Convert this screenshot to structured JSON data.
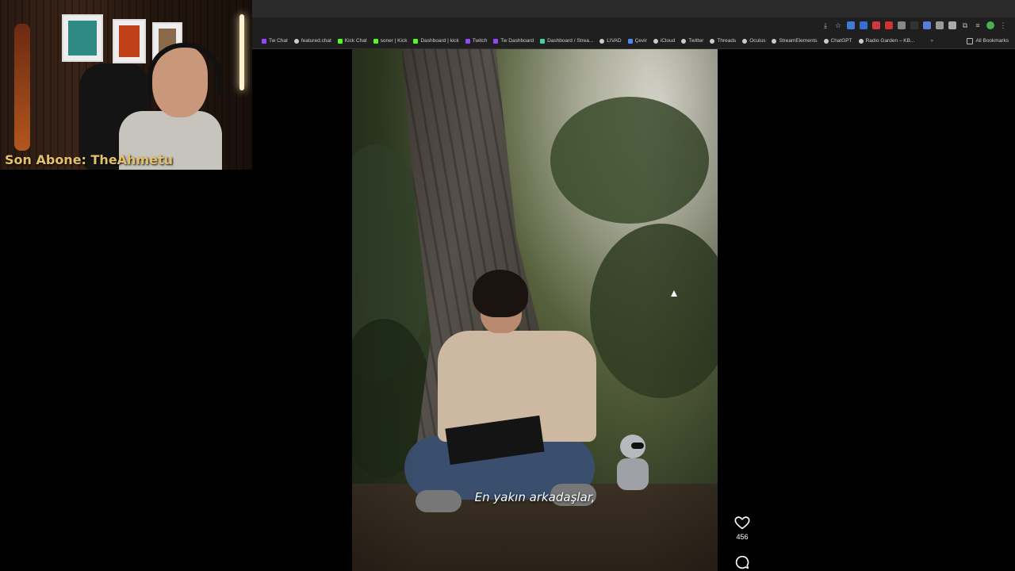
{
  "webcam": {
    "overlay_label": "Son Abone: TheAhmetu"
  },
  "browser": {
    "bookmarks": [
      {
        "label": "Tw Chat",
        "icon": "twitch-icon",
        "color": "#9146ff"
      },
      {
        "label": "featured.chat",
        "icon": "globe-icon",
        "color": "#cccccc"
      },
      {
        "label": "Kick Chat",
        "icon": "kick-icon",
        "color": "#53fc18"
      },
      {
        "label": "soner | Kick",
        "icon": "kick-icon",
        "color": "#53fc18"
      },
      {
        "label": "Dashboard | kick",
        "icon": "kick-icon",
        "color": "#53fc18"
      },
      {
        "label": "Twitch",
        "icon": "twitch-icon",
        "color": "#9146ff"
      },
      {
        "label": "Tw Dashboard",
        "icon": "twitch-icon",
        "color": "#9146ff"
      },
      {
        "label": "Dashboard / Strea...",
        "icon": "dashboard-icon",
        "color": "#3ad6a8"
      },
      {
        "label": "LIVAD",
        "icon": "globe-icon",
        "color": "#cccccc"
      },
      {
        "label": "Çevir",
        "icon": "translate-icon",
        "color": "#4a8af4"
      },
      {
        "label": "iCloud",
        "icon": "apple-icon",
        "color": "#cccccc"
      },
      {
        "label": "Twitter",
        "icon": "globe-icon",
        "color": "#cccccc"
      },
      {
        "label": "Threads",
        "icon": "threads-icon",
        "color": "#cccccc"
      },
      {
        "label": "Oculus",
        "icon": "globe-icon",
        "color": "#cccccc"
      },
      {
        "label": "StreamElements",
        "icon": "globe-icon",
        "color": "#cccccc"
      },
      {
        "label": "ChatGPT",
        "icon": "chatgpt-icon",
        "color": "#cccccc"
      },
      {
        "label": "Radio Garden – KB...",
        "icon": "globe-icon",
        "color": "#cccccc"
      }
    ],
    "more_label": "»",
    "all_bookmarks_label": "All Bookmarks"
  },
  "video": {
    "caption": "En yakın arkadaşlar,",
    "like_count": "456"
  }
}
